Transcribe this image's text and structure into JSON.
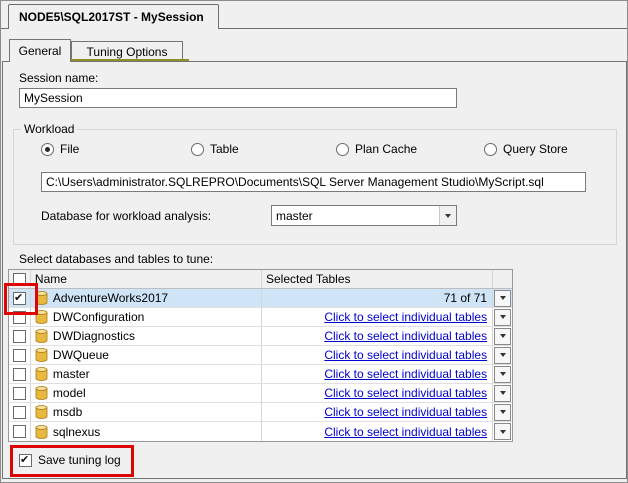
{
  "window": {
    "tab_title": "NODE5\\SQL2017ST - MySession"
  },
  "tabs": {
    "general": "General",
    "tuning_options": "Tuning Options"
  },
  "session": {
    "label": "Session name:",
    "value": "MySession"
  },
  "workload": {
    "label": "Workload",
    "options": [
      {
        "label": "File",
        "selected": true
      },
      {
        "label": "Table",
        "selected": false
      },
      {
        "label": "Plan Cache",
        "selected": false
      },
      {
        "label": "Query Store",
        "selected": false
      }
    ],
    "file_path": "C:\\Users\\administrator.SQLREPRO\\Documents\\SQL Server Management Studio\\MyScript.sql",
    "database_label": "Database for workload analysis:",
    "database_value": "master"
  },
  "tune_section": {
    "label": "Select databases and tables to tune:",
    "columns": {
      "name": "Name",
      "selected_tables": "Selected Tables"
    },
    "rows": [
      {
        "name": "AdventureWorks2017",
        "checked": true,
        "selected": true,
        "tables": "71 of 71",
        "link": false
      },
      {
        "name": "DWConfiguration",
        "checked": false,
        "selected": false,
        "tables": "Click to select individual tables",
        "link": true
      },
      {
        "name": "DWDiagnostics",
        "checked": false,
        "selected": false,
        "tables": "Click to select individual tables",
        "link": true
      },
      {
        "name": "DWQueue",
        "checked": false,
        "selected": false,
        "tables": "Click to select individual tables",
        "link": true
      },
      {
        "name": "master",
        "checked": false,
        "selected": false,
        "tables": "Click to select individual tables",
        "link": true
      },
      {
        "name": "model",
        "checked": false,
        "selected": false,
        "tables": "Click to select individual tables",
        "link": true
      },
      {
        "name": "msdb",
        "checked": false,
        "selected": false,
        "tables": "Click to select individual tables",
        "link": true
      },
      {
        "name": "sqlnexus",
        "checked": false,
        "selected": false,
        "tables": "Click to select individual tables",
        "link": true
      }
    ]
  },
  "footer": {
    "save_log_label": "Save tuning log",
    "checked": true
  },
  "colors": {
    "highlight_red": "#dd0606",
    "selected_row": "#cfe4f7",
    "link_blue": "#0000cc"
  }
}
